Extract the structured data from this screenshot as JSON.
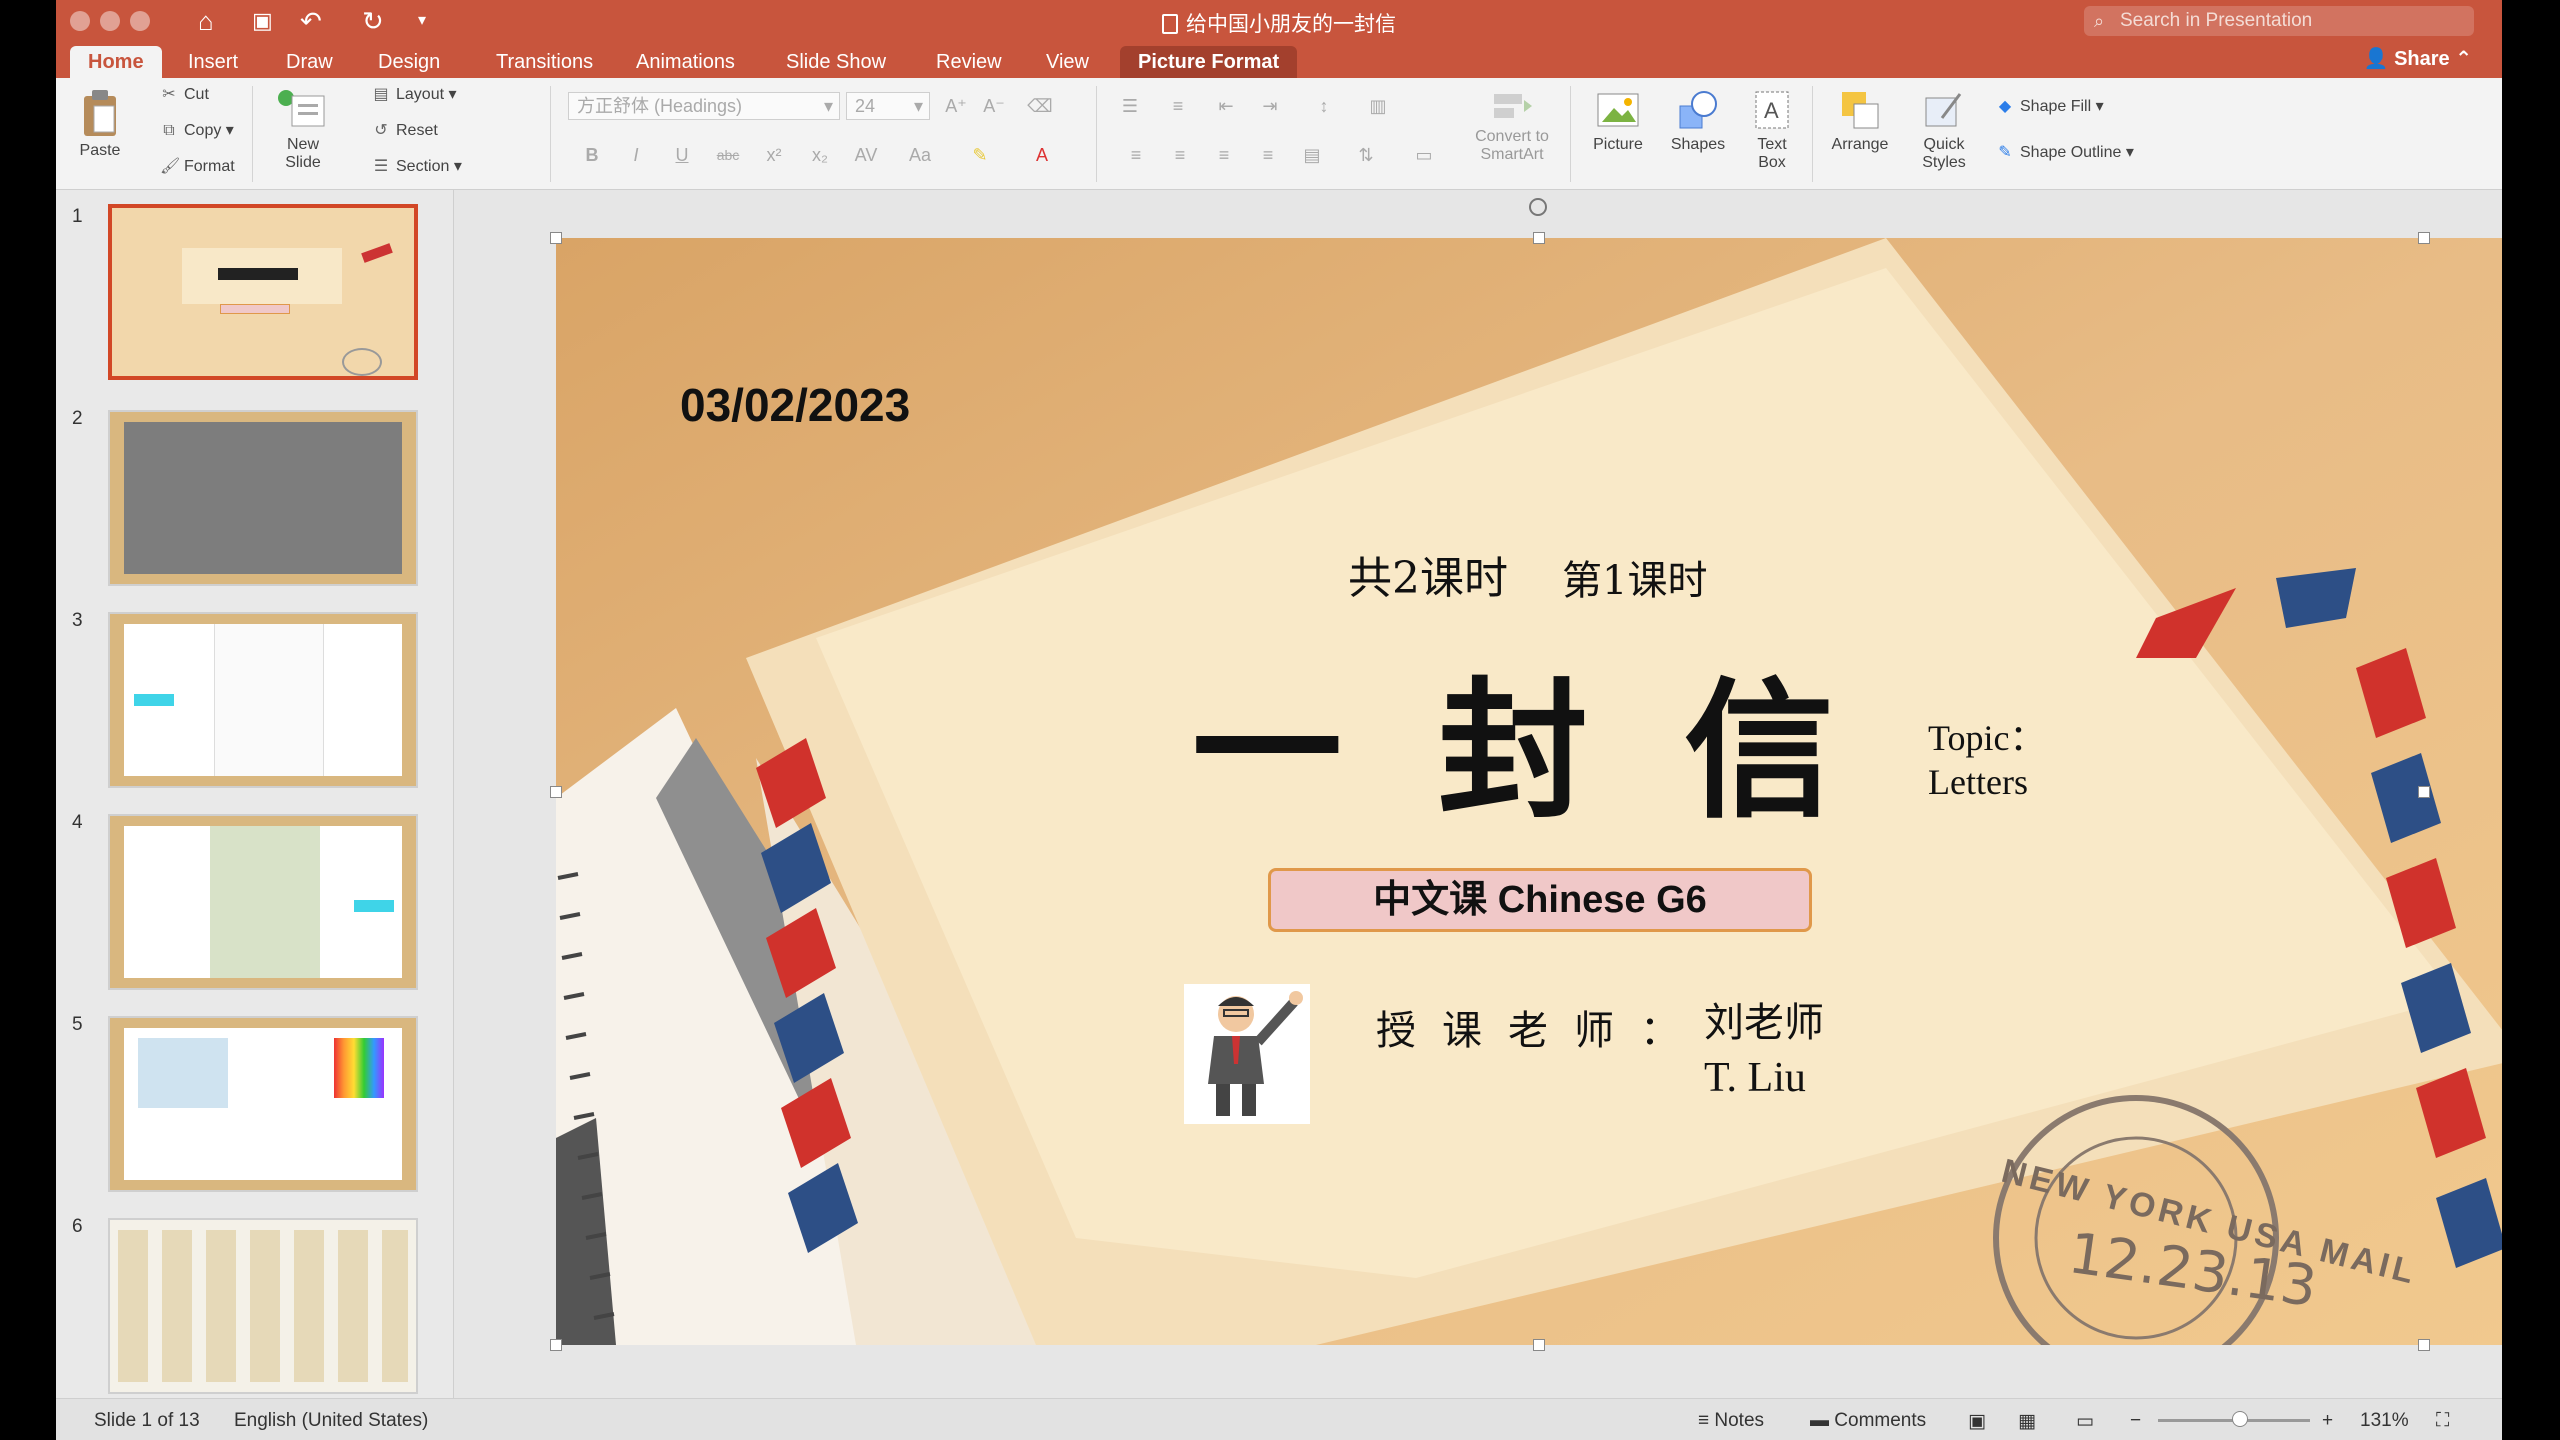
{
  "window": {
    "title": "给中国小朋友的一封信"
  },
  "search": {
    "placeholder": "Search in Presentation"
  },
  "tabs": [
    {
      "label": "Home"
    },
    {
      "label": "Insert"
    },
    {
      "label": "Draw"
    },
    {
      "label": "Design"
    },
    {
      "label": "Transitions"
    },
    {
      "label": "Animations"
    },
    {
      "label": "Slide Show"
    },
    {
      "label": "Review"
    },
    {
      "label": "View"
    },
    {
      "label": "Picture Format"
    }
  ],
  "share_label": "Share",
  "ribbon": {
    "paste": "Paste",
    "cut": "Cut",
    "copy": "Copy",
    "format": "Format",
    "new_slide": [
      "New",
      "Slide"
    ],
    "layout": "Layout",
    "reset": "Reset",
    "section": "Section",
    "font_name": "方正舒体 (Headings)",
    "font_size": "24",
    "convert_smartart": [
      "Convert to",
      "SmartArt"
    ],
    "picture": "Picture",
    "shapes": "Shapes",
    "text_box": [
      "Text",
      "Box"
    ],
    "arrange": "Arrange",
    "quick_styles": [
      "Quick",
      "Styles"
    ],
    "shape_fill": "Shape Fill",
    "shape_outline": "Shape Outline"
  },
  "thumbnails": [
    "1",
    "2",
    "3",
    "4",
    "5",
    "6"
  ],
  "slide": {
    "date": "03/02/2023",
    "lesson_total": "共2课时",
    "lesson_current": "第1课时",
    "title": "一封信",
    "topic_label": "Topic：",
    "topic_value": "Letters",
    "course": "中文课 Chinese G6",
    "teacher_label": "授课老师：",
    "teacher_name": "刘老师",
    "teacher_en": "T. Liu",
    "stamp_ring": "NEW YORK USA MAIL",
    "stamp_date": "12.23.13"
  },
  "status": {
    "slide_counter": "Slide 1 of 13",
    "language": "English (United States)",
    "notes": "Notes",
    "comments": "Comments",
    "zoom": "131%"
  },
  "colors": {
    "accent": "#c8553d",
    "selected_thumb": "#d24726"
  }
}
